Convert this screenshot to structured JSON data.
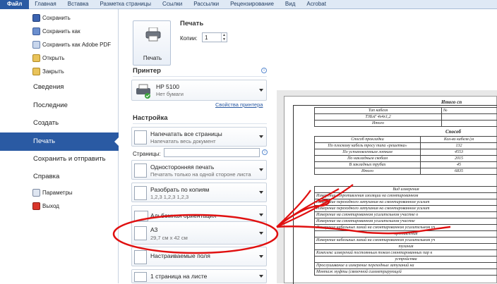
{
  "ribbon": {
    "tabs": [
      "Файл",
      "Главная",
      "Вставка",
      "Разметка страницы",
      "Ссылки",
      "Рассылки",
      "Рецензирование",
      "Вид",
      "Acrobat"
    ]
  },
  "nav": {
    "commands": [
      {
        "label": "Сохранить",
        "icon": "save-icon"
      },
      {
        "label": "Сохранить как",
        "icon": "save-as-icon"
      },
      {
        "label": "Сохранить как Adobe PDF",
        "icon": "pdf-icon"
      },
      {
        "label": "Открыть",
        "icon": "open-folder-icon"
      },
      {
        "label": "Закрыть",
        "icon": "close-folder-icon"
      }
    ],
    "items": [
      "Сведения",
      "Последние",
      "Создать",
      "Печать",
      "Сохранить и отправить",
      "Справка"
    ],
    "bottom": [
      {
        "label": "Параметры",
        "icon": "options-icon"
      },
      {
        "label": "Выход",
        "icon": "exit-icon"
      }
    ]
  },
  "print": {
    "button_label": "Печать",
    "heading": "Печать",
    "copies_label": "Копии:",
    "copies_value": "1",
    "printer_heading": "Принтер",
    "printer_name": "HP 5100",
    "printer_status": "Нет бумаги",
    "printer_props_link": "Свойства принтера",
    "settings_heading": "Настройка",
    "pages_label": "Страницы:",
    "settings": [
      {
        "title": "Напечатать все страницы",
        "sub": "Напечатать весь документ"
      },
      {
        "title": "Односторонняя печать",
        "sub": "Печатать только на одной стороне листа"
      },
      {
        "title": "Разобрать по копиям",
        "sub": "1,2,3    1,2,3    1,2,3"
      },
      {
        "title": "Альбомная ориентация",
        "sub": ""
      },
      {
        "title": "A3",
        "sub": "29,7 см x 42 см"
      },
      {
        "title": "Настраиваемые поля",
        "sub": ""
      },
      {
        "title": "1 страница на листе",
        "sub": ""
      }
    ]
  },
  "preview": {
    "title1": "Итого сп",
    "table1": [
      [
        "Тип кабеля",
        "№"
      ],
      [
        "ТЗБлГ 4х4х1,2",
        ""
      ],
      [
        "Итого",
        ""
      ]
    ],
    "title2": "Способ",
    "table2_header": [
      "Способ прокладки",
      "Кол-во кабеля (м"
    ],
    "table2": [
      [
        "По плоскому кабель тросу типа «решетка»",
        "132"
      ],
      [
        "По установленным лоткам",
        "4553"
      ],
      [
        "По накладным скобам",
        "2015"
      ],
      [
        "В закладных трубах",
        "45"
      ],
      [
        "Итого",
        "6835"
      ]
    ],
    "table3_header": "Вид измерения",
    "table3": [
      "Измерение сопротивления изоляции на смонтированном",
      "Измерение переходного затухания на смонтированном усилит",
      "Измерение переходного затухания на смонтированном усилит",
      "Измерение на смонтированном усилительном участке о",
      "Измерение на смонтированном усилительном участке",
      "Измерение кабельных линий на смонтированном усилительном уч",
      "противления",
      "Измерение кабельных линий на смонтированном усилительном уч",
      "тухания",
      "Комплекс измерений постоянным током смонтированных пар к",
      "устройства",
      "Прослушивание и измерение переходных затуханий на",
      "Монтаж муфты (связочной симметрирующей"
    ]
  }
}
